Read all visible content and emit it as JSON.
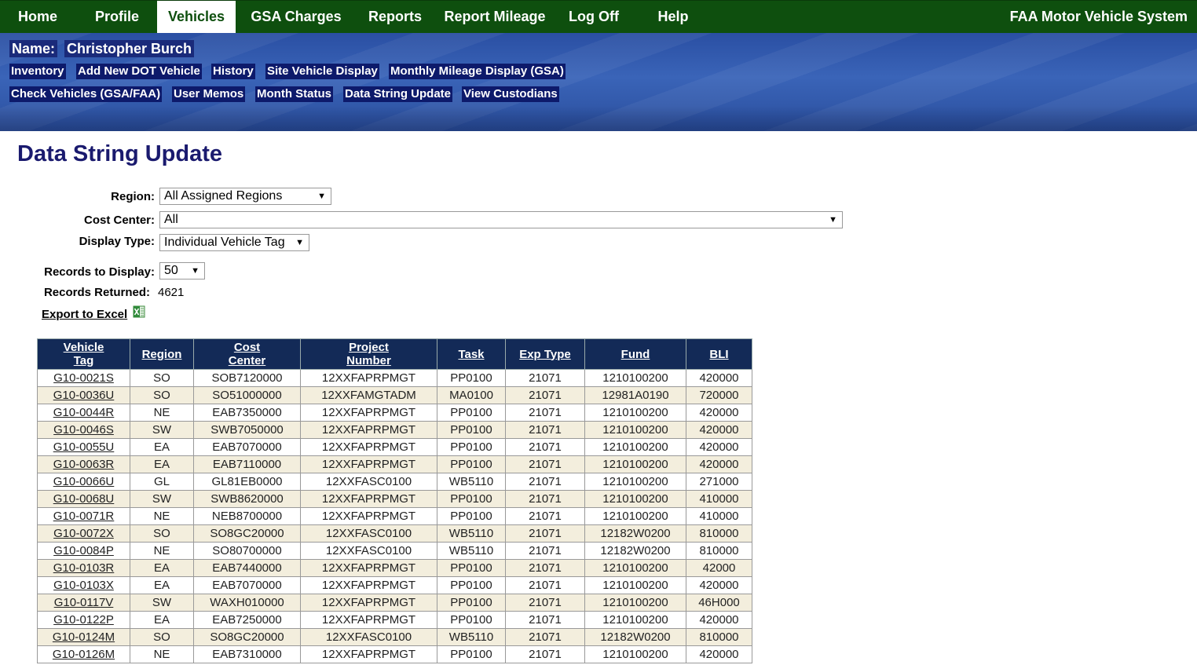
{
  "nav": {
    "items": [
      {
        "label": "Home"
      },
      {
        "label": "Profile"
      },
      {
        "label": "Vehicles"
      },
      {
        "label": "GSA Charges"
      },
      {
        "label": "Reports"
      },
      {
        "label": "Report Mileage"
      },
      {
        "label": "Log Off"
      },
      {
        "label": "Help"
      }
    ],
    "active": "Vehicles",
    "system_title": "FAA Motor Vehicle System"
  },
  "user": {
    "name_label": "Name:",
    "name": "Christopher Burch"
  },
  "sublinks": {
    "row1": [
      "Inventory",
      "Add New DOT Vehicle",
      "History",
      "Site Vehicle Display",
      "Monthly Mileage Display (GSA)"
    ],
    "row2": [
      "Check Vehicles (GSA/FAA)",
      "User Memos",
      "Month Status",
      "Data String Update",
      "View Custodians"
    ]
  },
  "page": {
    "title": "Data String Update"
  },
  "filters": {
    "region": {
      "label": "Region:",
      "value": "All Assigned Regions"
    },
    "cost_center": {
      "label": "Cost Center:",
      "value": "All"
    },
    "display_type": {
      "label": "Display Type:",
      "value": "Individual Vehicle Tag"
    },
    "records_to_display": {
      "label": "Records to Display:",
      "value": "50"
    },
    "records_returned": {
      "label": "Records Returned:",
      "value": "4621"
    }
  },
  "export": {
    "label": "Export to Excel",
    "icon": "excel-icon"
  },
  "table": {
    "headers": [
      {
        "line1": "Vehicle",
        "line2": "Tag"
      },
      {
        "line1": "Region",
        "line2": ""
      },
      {
        "line1": "Cost",
        "line2": "Center"
      },
      {
        "line1": "Project",
        "line2": "Number"
      },
      {
        "line1": "Task",
        "line2": ""
      },
      {
        "line1": "Exp Type",
        "line2": ""
      },
      {
        "line1": "Fund",
        "line2": ""
      },
      {
        "line1": "BLI",
        "line2": ""
      }
    ],
    "rows": [
      [
        "G10-0021S",
        "SO",
        "SOB7120000",
        "12XXFAPRPMGT",
        "PP0100",
        "21071",
        "1210100200",
        "420000"
      ],
      [
        "G10-0036U",
        "SO",
        "SO51000000",
        "12XXFAMGTADM",
        "MA0100",
        "21071",
        "12981A0190",
        "720000"
      ],
      [
        "G10-0044R",
        "NE",
        "EAB7350000",
        "12XXFAPRPMGT",
        "PP0100",
        "21071",
        "1210100200",
        "420000"
      ],
      [
        "G10-0046S",
        "SW",
        "SWB7050000",
        "12XXFAPRPMGT",
        "PP0100",
        "21071",
        "1210100200",
        "420000"
      ],
      [
        "G10-0055U",
        "EA",
        "EAB7070000",
        "12XXFAPRPMGT",
        "PP0100",
        "21071",
        "1210100200",
        "420000"
      ],
      [
        "G10-0063R",
        "EA",
        "EAB7110000",
        "12XXFAPRPMGT",
        "PP0100",
        "21071",
        "1210100200",
        "420000"
      ],
      [
        "G10-0066U",
        "GL",
        "GL81EB0000",
        "12XXFASC0100",
        "WB5110",
        "21071",
        "1210100200",
        "271000"
      ],
      [
        "G10-0068U",
        "SW",
        "SWB8620000",
        "12XXFAPRPMGT",
        "PP0100",
        "21071",
        "1210100200",
        "410000"
      ],
      [
        "G10-0071R",
        "NE",
        "NEB8700000",
        "12XXFAPRPMGT",
        "PP0100",
        "21071",
        "1210100200",
        "410000"
      ],
      [
        "G10-0072X",
        "SO",
        "SO8GC20000",
        "12XXFASC0100",
        "WB5110",
        "21071",
        "12182W0200",
        "810000"
      ],
      [
        "G10-0084P",
        "NE",
        "SO80700000",
        "12XXFASC0100",
        "WB5110",
        "21071",
        "12182W0200",
        "810000"
      ],
      [
        "G10-0103R",
        "EA",
        "EAB7440000",
        "12XXFAPRPMGT",
        "PP0100",
        "21071",
        "1210100200",
        "42000"
      ],
      [
        "G10-0103X",
        "EA",
        "EAB7070000",
        "12XXFAPRPMGT",
        "PP0100",
        "21071",
        "1210100200",
        "420000"
      ],
      [
        "G10-0117V",
        "SW",
        "WAXH010000",
        "12XXFAPRPMGT",
        "PP0100",
        "21071",
        "1210100200",
        "46H000"
      ],
      [
        "G10-0122P",
        "EA",
        "EAB7250000",
        "12XXFAPRPMGT",
        "PP0100",
        "21071",
        "1210100200",
        "420000"
      ],
      [
        "G10-0124M",
        "SO",
        "SO8GC20000",
        "12XXFASC0100",
        "WB5110",
        "21071",
        "12182W0200",
        "810000"
      ],
      [
        "G10-0126M",
        "NE",
        "EAB7310000",
        "12XXFAPRPMGT",
        "PP0100",
        "21071",
        "1210100200",
        "420000"
      ]
    ]
  }
}
